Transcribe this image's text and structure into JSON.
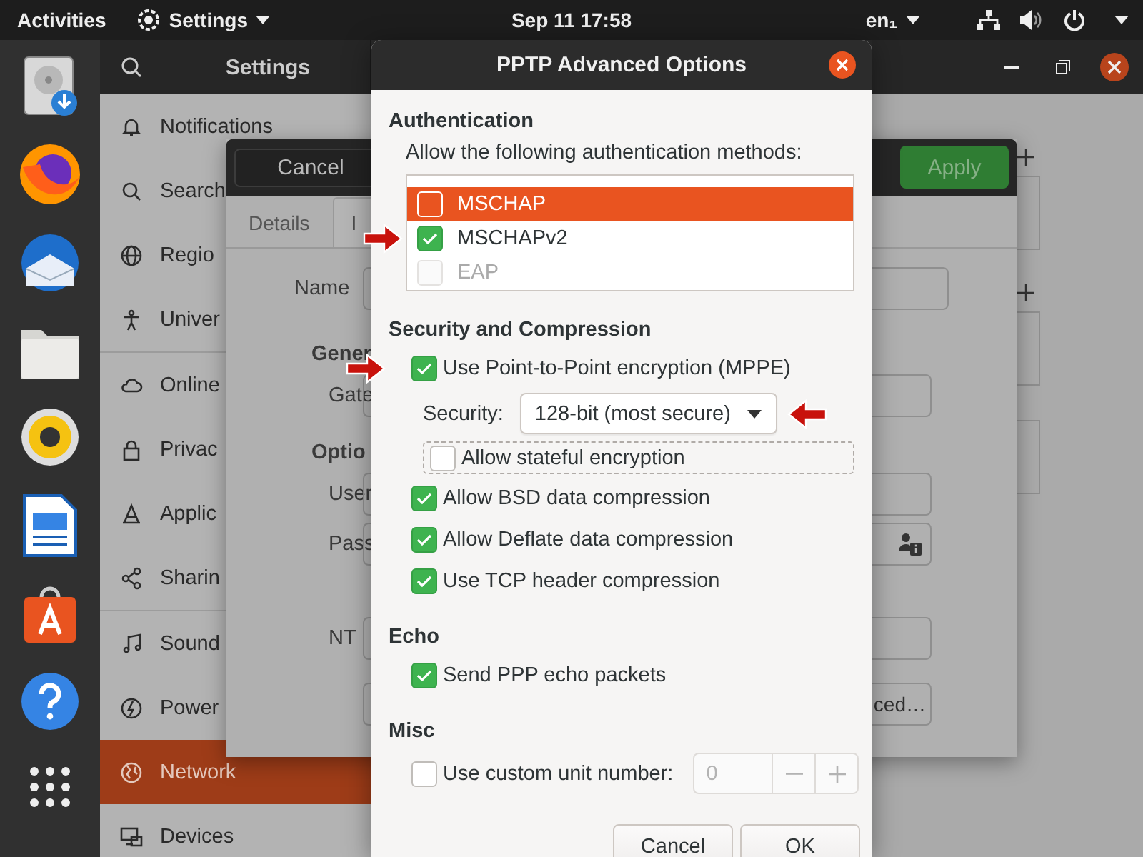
{
  "top_bar": {
    "activities": "Activities",
    "app_menu": "Settings",
    "clock": "Sep 11  17:58",
    "input_source": "en₁"
  },
  "settings_window": {
    "title": "Settings",
    "sidebar": {
      "groups": [
        [
          {
            "label": "Notifications",
            "selected": false
          },
          {
            "label": "Search",
            "selected": false
          },
          {
            "label": "Regio",
            "selected": false
          },
          {
            "label": "Univer",
            "selected": false
          }
        ],
        [
          {
            "label": "Online",
            "selected": false
          },
          {
            "label": "Privac",
            "selected": false
          },
          {
            "label": "Applic",
            "selected": false
          },
          {
            "label": "Sharin",
            "selected": false
          }
        ],
        [
          {
            "label": "Sound",
            "selected": false
          },
          {
            "label": "Power",
            "selected": false
          },
          {
            "label": "Network",
            "selected": true
          },
          {
            "label": "Devices",
            "selected": false
          }
        ]
      ]
    }
  },
  "connection_dialog": {
    "cancel_button": "Cancel",
    "apply_button": "Apply",
    "tabs": [
      {
        "label": "Details",
        "selected": false
      },
      {
        "label": "I",
        "selected": true
      }
    ],
    "name_label": "Name",
    "general_heading": "Gener",
    "gateway_label": "Gate",
    "options_heading": "Optio",
    "user_label": "User",
    "password_label": "Pass",
    "nt_domain_label": "NT",
    "advanced_button": "ced…"
  },
  "advanced_dialog": {
    "title": "PPTP Advanced Options",
    "sections": [
      {
        "kind": "methods",
        "heading": "Authentication",
        "caption": "Allow the following authentication methods:",
        "items": [
          {
            "label": "MSCHAP",
            "selected": true,
            "checked": false,
            "disabled": false,
            "arrow": false
          },
          {
            "label": "MSCHAPv2",
            "selected": false,
            "checked": true,
            "disabled": false,
            "arrow": true
          },
          {
            "label": "EAP",
            "selected": false,
            "checked": false,
            "disabled": true,
            "arrow": false
          }
        ]
      },
      {
        "kind": "options",
        "heading": "Security and Compression",
        "items": [
          {
            "kind": "check",
            "label": "Use Point-to-Point encryption (MPPE)",
            "checked": true,
            "arrow": true
          },
          {
            "kind": "combo",
            "label": "Security:",
            "value": "128-bit (most secure)",
            "arrow": true
          },
          {
            "kind": "subcheck",
            "label": "Allow stateful encryption",
            "checked": false,
            "focused": true,
            "arrow": false
          },
          {
            "kind": "check",
            "label": "Allow BSD data compression",
            "checked": true,
            "arrow": false
          },
          {
            "kind": "check",
            "label": "Allow Deflate data compression",
            "checked": true,
            "arrow": false
          },
          {
            "kind": "check",
            "label": "Use TCP header compression",
            "checked": true,
            "arrow": false
          }
        ]
      },
      {
        "kind": "options",
        "heading": "Echo",
        "items": [
          {
            "kind": "check",
            "label": "Send PPP echo packets",
            "checked": true,
            "arrow": false
          }
        ]
      },
      {
        "kind": "options",
        "heading": "Misc",
        "items": [
          {
            "kind": "spin",
            "label": "Use custom unit number:",
            "checked": false,
            "value": "0",
            "disabled": true,
            "arrow": false
          }
        ]
      }
    ],
    "buttons": [
      {
        "label": "Cancel"
      },
      {
        "label": "OK"
      }
    ]
  }
}
